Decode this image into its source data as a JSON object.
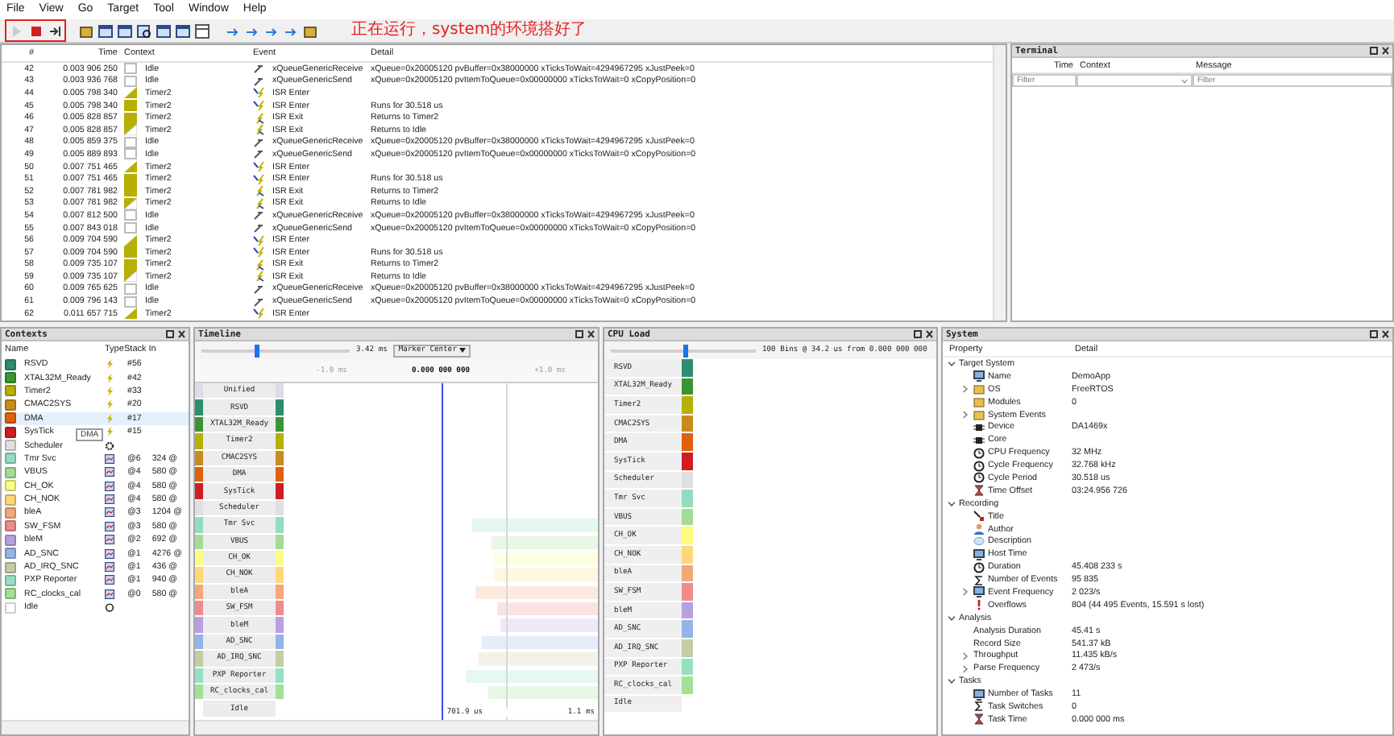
{
  "menu": [
    "File",
    "View",
    "Go",
    "Target",
    "Tool",
    "Window",
    "Help"
  ],
  "toolbar": {
    "groups": [
      {
        "highlighted": true,
        "buttons": [
          {
            "kind": "play",
            "disabled": true
          },
          {
            "kind": "stop",
            "disabled": false
          },
          {
            "kind": "step",
            "disabled": false
          }
        ]
      },
      {
        "highlighted": false,
        "buttons": [
          {
            "kind": "box",
            "disabled": false
          },
          {
            "kind": "window",
            "disabled": false
          },
          {
            "kind": "window",
            "disabled": false
          },
          {
            "kind": "find",
            "disabled": false
          },
          {
            "kind": "window",
            "disabled": false
          },
          {
            "kind": "window",
            "disabled": false
          },
          {
            "kind": "panel",
            "disabled": false
          }
        ]
      },
      {
        "highlighted": false,
        "buttons": [
          {
            "kind": "arrow",
            "disabled": false
          },
          {
            "kind": "arrow",
            "disabled": false
          },
          {
            "kind": "arrow",
            "disabled": false
          },
          {
            "kind": "arrow",
            "disabled": false
          },
          {
            "kind": "box",
            "disabled": false
          }
        ]
      }
    ]
  },
  "annotation": {
    "text": "正在运行，system的环境搭好了"
  },
  "events": {
    "columns": [
      "#",
      "Time",
      "Context",
      "Event",
      "Detail"
    ],
    "rows": [
      {
        "no": "42",
        "time": "0.003 906 250",
        "context": {
          "name": "Idle",
          "kind": "none"
        },
        "event": {
          "name": "xQueueGenericReceive",
          "kind": "queue"
        },
        "detail": "xQueue=0x20005120 pvBuffer=0x38000000 xTicksToWait=4294967295 xJustPeek=0"
      },
      {
        "no": "43",
        "time": "0.003 936 768",
        "context": {
          "name": "Idle",
          "kind": "none"
        },
        "event": {
          "name": "xQueueGenericSend",
          "kind": "queue"
        },
        "detail": "xQueue=0x20005120 pvItemToQueue=0x00000000 xTicksToWait=0 xCopyPosition=0"
      },
      {
        "no": "44",
        "time": "0.005 798 340",
        "context": {
          "name": "Timer2",
          "kind": "start"
        },
        "event": {
          "name": "ISR Enter",
          "kind": "isr_enter"
        }
      },
      {
        "no": "45",
        "time": "0.005 798 340",
        "context": {
          "name": "Timer2",
          "kind": "full"
        },
        "event": {
          "name": "ISR Enter",
          "kind": "isr_enter"
        },
        "detail": "Runs for 30.518 us"
      },
      {
        "no": "46",
        "time": "0.005 828 857",
        "context": {
          "name": "Timer2",
          "kind": "full"
        },
        "event": {
          "name": "ISR Exit",
          "kind": "isr_exit"
        },
        "detail": "Returns to Timer2"
      },
      {
        "no": "47",
        "time": "0.005 828 857",
        "context": {
          "name": "Timer2",
          "kind": "end"
        },
        "event": {
          "name": "ISR Exit",
          "kind": "isr_exit"
        },
        "detail": "Returns to Idle"
      },
      {
        "no": "48",
        "time": "0.005 859 375",
        "context": {
          "name": "Idle",
          "kind": "none"
        },
        "event": {
          "name": "xQueueGenericReceive",
          "kind": "queue"
        },
        "detail": "xQueue=0x20005120 pvBuffer=0x38000000 xTicksToWait=4294967295 xJustPeek=0"
      },
      {
        "no": "49",
        "time": "0.005 889 893",
        "context": {
          "name": "Idle",
          "kind": "none"
        },
        "event": {
          "name": "xQueueGenericSend",
          "kind": "queue"
        },
        "detail": "xQueue=0x20005120 pvItemToQueue=0x00000000 xTicksToWait=0 xCopyPosition=0"
      },
      {
        "no": "50",
        "time": "0.007 751 465",
        "context": {
          "name": "Timer2",
          "kind": "start"
        },
        "event": {
          "name": "ISR Enter",
          "kind": "isr_enter"
        }
      },
      {
        "no": "51",
        "time": "0.007 751 465",
        "context": {
          "name": "Timer2",
          "kind": "full"
        },
        "event": {
          "name": "ISR Enter",
          "kind": "isr_enter"
        },
        "detail": "Runs for 30.518 us"
      },
      {
        "no": "52",
        "time": "0.007 781 982",
        "context": {
          "name": "Timer2",
          "kind": "full"
        },
        "event": {
          "name": "ISR Exit",
          "kind": "isr_exit"
        },
        "detail": "Returns to Timer2"
      },
      {
        "no": "53",
        "time": "0.007 781 982",
        "context": {
          "name": "Timer2",
          "kind": "end"
        },
        "event": {
          "name": "ISR Exit",
          "kind": "isr_exit"
        },
        "detail": "Returns to Idle"
      },
      {
        "no": "54",
        "time": "0.007 812 500",
        "context": {
          "name": "Idle",
          "kind": "none"
        },
        "event": {
          "name": "xQueueGenericReceive",
          "kind": "queue"
        },
        "detail": "xQueue=0x20005120 pvBuffer=0x38000000 xTicksToWait=4294967295 xJustPeek=0"
      },
      {
        "no": "55",
        "time": "0.007 843 018",
        "context": {
          "name": "Idle",
          "kind": "none"
        },
        "event": {
          "name": "xQueueGenericSend",
          "kind": "queue"
        },
        "detail": "xQueue=0x20005120 pvItemToQueue=0x00000000 xTicksToWait=0 xCopyPosition=0"
      },
      {
        "no": "56",
        "time": "0.009 704 590",
        "context": {
          "name": "Timer2",
          "kind": "start"
        },
        "event": {
          "name": "ISR Enter",
          "kind": "isr_enter"
        }
      },
      {
        "no": "57",
        "time": "0.009 704 590",
        "context": {
          "name": "Timer2",
          "kind": "full"
        },
        "event": {
          "name": "ISR Enter",
          "kind": "isr_enter"
        },
        "detail": "Runs for 30.518 us"
      },
      {
        "no": "58",
        "time": "0.009 735 107",
        "context": {
          "name": "Timer2",
          "kind": "full"
        },
        "event": {
          "name": "ISR Exit",
          "kind": "isr_exit"
        },
        "detail": "Returns to Timer2"
      },
      {
        "no": "59",
        "time": "0.009 735 107",
        "context": {
          "name": "Timer2",
          "kind": "end"
        },
        "event": {
          "name": "ISR Exit",
          "kind": "isr_exit"
        },
        "detail": "Returns to Idle"
      },
      {
        "no": "60",
        "time": "0.009 765 625",
        "context": {
          "name": "Idle",
          "kind": "none"
        },
        "event": {
          "name": "xQueueGenericReceive",
          "kind": "queue"
        },
        "detail": "xQueue=0x20005120 pvBuffer=0x38000000 xTicksToWait=4294967295 xJustPeek=0"
      },
      {
        "no": "61",
        "time": "0.009 796 143",
        "context": {
          "name": "Idle",
          "kind": "none"
        },
        "event": {
          "name": "xQueueGenericSend",
          "kind": "queue"
        },
        "detail": "xQueue=0x20005120 pvItemToQueue=0x00000000 xTicksToWait=0 xCopyPosition=0"
      },
      {
        "no": "62",
        "time": "0.011 657 715",
        "context": {
          "name": "Timer2",
          "kind": "start"
        },
        "event": {
          "name": "ISR Enter",
          "kind": "isr_enter"
        }
      }
    ]
  },
  "terminal": {
    "title": "Terminal",
    "columns": [
      "Time",
      "Context",
      "Message"
    ],
    "filters": [
      {
        "placeholder": "Filter"
      },
      {
        "placeholder": "Filter"
      }
    ]
  },
  "contexts": {
    "title": "Contexts",
    "columns": [
      "Name",
      "Type",
      "Stack In"
    ],
    "tooltip": "DMA",
    "rows": [
      {
        "name": "RSVD",
        "color": "#2e8c70",
        "kind": "isr",
        "type": "#56",
        "selected": false
      },
      {
        "name": "XTAL32M_Ready",
        "color": "#3a9434",
        "kind": "isr",
        "type": "#42",
        "selected": false
      },
      {
        "name": "Timer2",
        "color": "#b8b000",
        "kind": "isr",
        "type": "#33",
        "selected": false
      },
      {
        "name": "CMAC2SYS",
        "color": "#c88c1c",
        "kind": "isr",
        "type": "#20",
        "selected": false
      },
      {
        "name": "DMA",
        "color": "#e0600c",
        "kind": "isr",
        "type": "#17",
        "selected": true
      },
      {
        "name": "SysTick",
        "color": "#d01c24",
        "kind": "isr",
        "type": "#15",
        "selected": false
      },
      {
        "name": "Scheduler",
        "color": "#e0e0e0",
        "kind": "scheduler",
        "selected": false
      },
      {
        "name": "Tmr Svc",
        "color": "#94dcc0",
        "kind": "task",
        "type": "@6",
        "stack": "324 @",
        "selected": false
      },
      {
        "name": "VBUS",
        "color": "#a4dc94",
        "kind": "task",
        "type": "@4",
        "stack": "580 @",
        "selected": false
      },
      {
        "name": "CH_OK",
        "color": "#fcfc80",
        "kind": "task",
        "type": "@4",
        "stack": "580 @",
        "selected": false
      },
      {
        "name": "CH_NOK",
        "color": "#fcd878",
        "kind": "task",
        "type": "@4",
        "stack": "580 @",
        "selected": false
      },
      {
        "name": "bleA",
        "color": "#f4a878",
        "kind": "task",
        "type": "@3",
        "stack": "1204 @",
        "selected": false
      },
      {
        "name": "SW_FSM",
        "color": "#ec8c8c",
        "kind": "task",
        "type": "@3",
        "stack": "580 @",
        "selected": false
      },
      {
        "name": "bleM",
        "color": "#b8a0e0",
        "kind": "task",
        "type": "@2",
        "stack": "692 @",
        "selected": false
      },
      {
        "name": "AD_SNC",
        "color": "#94b4e8",
        "kind": "task",
        "type": "@1",
        "stack": "4276 @",
        "selected": false
      },
      {
        "name": "AD_IRQ_SNC",
        "color": "#c4cca4",
        "kind": "task",
        "type": "@1",
        "stack": "436 @",
        "selected": false
      },
      {
        "name": "PXP Reporter",
        "color": "#94e0c4",
        "kind": "task",
        "type": "@1",
        "stack": "940 @",
        "selected": false
      },
      {
        "name": "RC_clocks_cal",
        "color": "#a4e094",
        "kind": "task",
        "type": "@0",
        "stack": "580 @",
        "selected": false
      },
      {
        "name": "Idle",
        "color": "#ffffff",
        "kind": "idle",
        "selected": false
      }
    ]
  },
  "timeline": {
    "title": "Timeline",
    "zoom": {
      "level": 0.36,
      "reading": "3.42 ms"
    },
    "mode": "Marker Center",
    "ticks": [
      "-1.0 ms",
      "0.000 000 000",
      "+1.0 ms"
    ],
    "measure": [
      "701.9 us",
      "1.1 ms"
    ],
    "rows": [
      {
        "label": "Unified",
        "color": "#dcdce8"
      },
      {
        "label": "RSVD",
        "color": "#2e8c70"
      },
      {
        "label": "XTAL32M_Ready",
        "color": "#3a9434"
      },
      {
        "label": "Timer2",
        "color": "#b8b000"
      },
      {
        "label": "CMAC2SYS",
        "color": "#c88c1c"
      },
      {
        "label": "DMA",
        "color": "#e0600c"
      },
      {
        "label": "SysTick",
        "color": "#d01c24"
      },
      {
        "label": "Scheduler",
        "color": "#e0e0e0"
      },
      {
        "label": "Tmr Svc",
        "color": "#94dcc0",
        "kind": "task"
      },
      {
        "label": "VBUS",
        "color": "#a4dc94",
        "kind": "task"
      },
      {
        "label": "CH_OK",
        "color": "#fcfc80",
        "kind": "task"
      },
      {
        "label": "CH_NOK",
        "color": "#fcd878",
        "kind": "task"
      },
      {
        "label": "bleA",
        "color": "#f4a878",
        "kind": "task"
      },
      {
        "label": "SW_FSM",
        "color": "#ec8c8c",
        "kind": "task"
      },
      {
        "label": "bleM",
        "color": "#b8a0e0",
        "kind": "task"
      },
      {
        "label": "AD_SNC",
        "color": "#94b4e8",
        "kind": "task"
      },
      {
        "label": "AD_IRQ_SNC",
        "color": "#c4cca4",
        "kind": "task"
      },
      {
        "label": "PXP Reporter",
        "color": "#94e0c4",
        "kind": "task"
      },
      {
        "label": "RC_clocks_cal",
        "color": "#a4e094",
        "kind": "task"
      },
      {
        "label": "Idle",
        "color": "#ffffff"
      }
    ]
  },
  "cpu_load": {
    "title": "CPU Load",
    "bins": {
      "level": 0.5,
      "reading": "100 Bins @ 34.2 us from 0.000 000 000"
    },
    "rows": [
      {
        "label": "RSVD",
        "color": "#2e8c70"
      },
      {
        "label": "XTAL32M_Ready",
        "color": "#3a9434"
      },
      {
        "label": "Timer2",
        "color": "#b8b000"
      },
      {
        "label": "CMAC2SYS",
        "color": "#c88c1c"
      },
      {
        "label": "DMA",
        "color": "#e0600c"
      },
      {
        "label": "SysTick",
        "color": "#d01c24"
      },
      {
        "label": "Scheduler",
        "color": "#e0e0e0"
      },
      {
        "label": "Tmr Svc",
        "color": "#94dcc0"
      },
      {
        "label": "VBUS",
        "color": "#a4dc94"
      },
      {
        "label": "CH_OK",
        "color": "#fcfc80"
      },
      {
        "label": "CH_NOK",
        "color": "#fcd878"
      },
      {
        "label": "bleA",
        "color": "#f4a878"
      },
      {
        "label": "SW_FSM",
        "color": "#ec8c8c"
      },
      {
        "label": "bleM",
        "color": "#b8a0e0"
      },
      {
        "label": "AD_SNC",
        "color": "#94b4e8"
      },
      {
        "label": "AD_IRQ_SNC",
        "color": "#c4cca4"
      },
      {
        "label": "PXP Reporter",
        "color": "#94e0c4"
      },
      {
        "label": "RC_clocks_cal",
        "color": "#a4e094"
      },
      {
        "label": "Idle",
        "color": "#ffffff"
      }
    ]
  },
  "system": {
    "title": "System",
    "columns": [
      "Property",
      "Detail"
    ],
    "items": [
      {
        "label": "Target System",
        "expanded": true,
        "children": [
          {
            "label": "Name",
            "detail": "DemoApp",
            "kind": "monitor"
          },
          {
            "label": "OS",
            "detail": "FreeRTOS",
            "kind": "box",
            "expanded": false
          },
          {
            "label": "Modules",
            "detail": "0",
            "kind": "box"
          },
          {
            "label": "System Events",
            "kind": "box",
            "expanded": false
          },
          {
            "label": "Device",
            "detail": "DA1469x",
            "kind": "chip"
          },
          {
            "label": "Core",
            "kind": "chip"
          },
          {
            "label": "CPU Frequency",
            "detail": "32 MHz",
            "kind": "clock"
          },
          {
            "label": "Cycle Frequency",
            "detail": "32.768 kHz",
            "kind": "clock"
          },
          {
            "label": "Cycle Period",
            "detail": "30.518 us",
            "kind": "clock"
          },
          {
            "label": "Time Offset",
            "detail": "03:24.956 726",
            "kind": "hourglass"
          }
        ]
      },
      {
        "label": "Recording",
        "expanded": true,
        "children": [
          {
            "label": "Title",
            "kind": "tag"
          },
          {
            "label": "Author",
            "kind": "person"
          },
          {
            "label": "Description",
            "kind": "bubble"
          },
          {
            "label": "Host Time",
            "kind": "monitor"
          },
          {
            "label": "Duration",
            "detail": "45.408 233 s",
            "kind": "clock"
          },
          {
            "label": "Number of Events",
            "detail": "95 835",
            "kind": "sum"
          },
          {
            "label": "Event Frequency",
            "detail": "2 023/s",
            "kind": "monitor",
            "expanded": false
          },
          {
            "label": "Overflows",
            "detail": "804 (44 495 Events, 15.591 s lost)",
            "kind": "warning"
          }
        ]
      },
      {
        "label": "Analysis",
        "expanded": true,
        "children": [
          {
            "label": "Analysis Duration",
            "detail": "45.41 s"
          },
          {
            "label": "Record Size",
            "detail": "541.37 kB"
          },
          {
            "label": "Throughput",
            "detail": "11.435 kB/s",
            "expanded": false
          },
          {
            "label": "Parse Frequency",
            "detail": "2 473/s",
            "expanded": false
          }
        ]
      },
      {
        "label": "Tasks",
        "expanded": true,
        "children": [
          {
            "label": "Number of Tasks",
            "detail": "11",
            "kind": "monitor"
          },
          {
            "label": "Task Switches",
            "detail": "0",
            "kind": "sum"
          },
          {
            "label": "Task Time",
            "detail": "0.000 000 ms",
            "kind": "hourglass"
          }
        ]
      }
    ]
  }
}
